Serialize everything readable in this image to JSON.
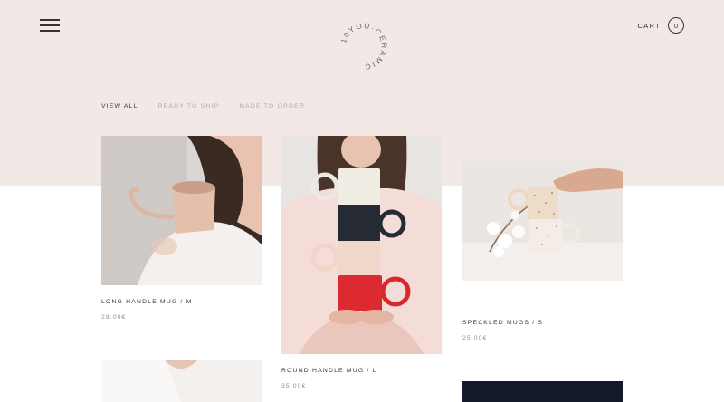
{
  "header": {
    "menu_icon": "hamburger-menu-icon",
    "logo_text": "10YOU·CERAMICS",
    "cart_label": "CART",
    "cart_count": "0"
  },
  "filters": [
    {
      "label": "VIEW ALL",
      "active": true
    },
    {
      "label": "READY TO SHIP",
      "active": false
    },
    {
      "label": "MADE TO ORDER",
      "active": false
    }
  ],
  "products": [
    {
      "title": "LONG HANDLE MUG / M",
      "price": "28.00€"
    },
    {
      "title": "ROUND HANDLE MUG / L",
      "price": "35.00€"
    },
    {
      "title": "SPECKLED MUGS / S",
      "price": "25.00€"
    }
  ],
  "colors": {
    "header_bg": "#f2e8e5",
    "text_dark": "#333333",
    "text_muted": "#b5a9a6",
    "price": "#9a8e8b"
  }
}
